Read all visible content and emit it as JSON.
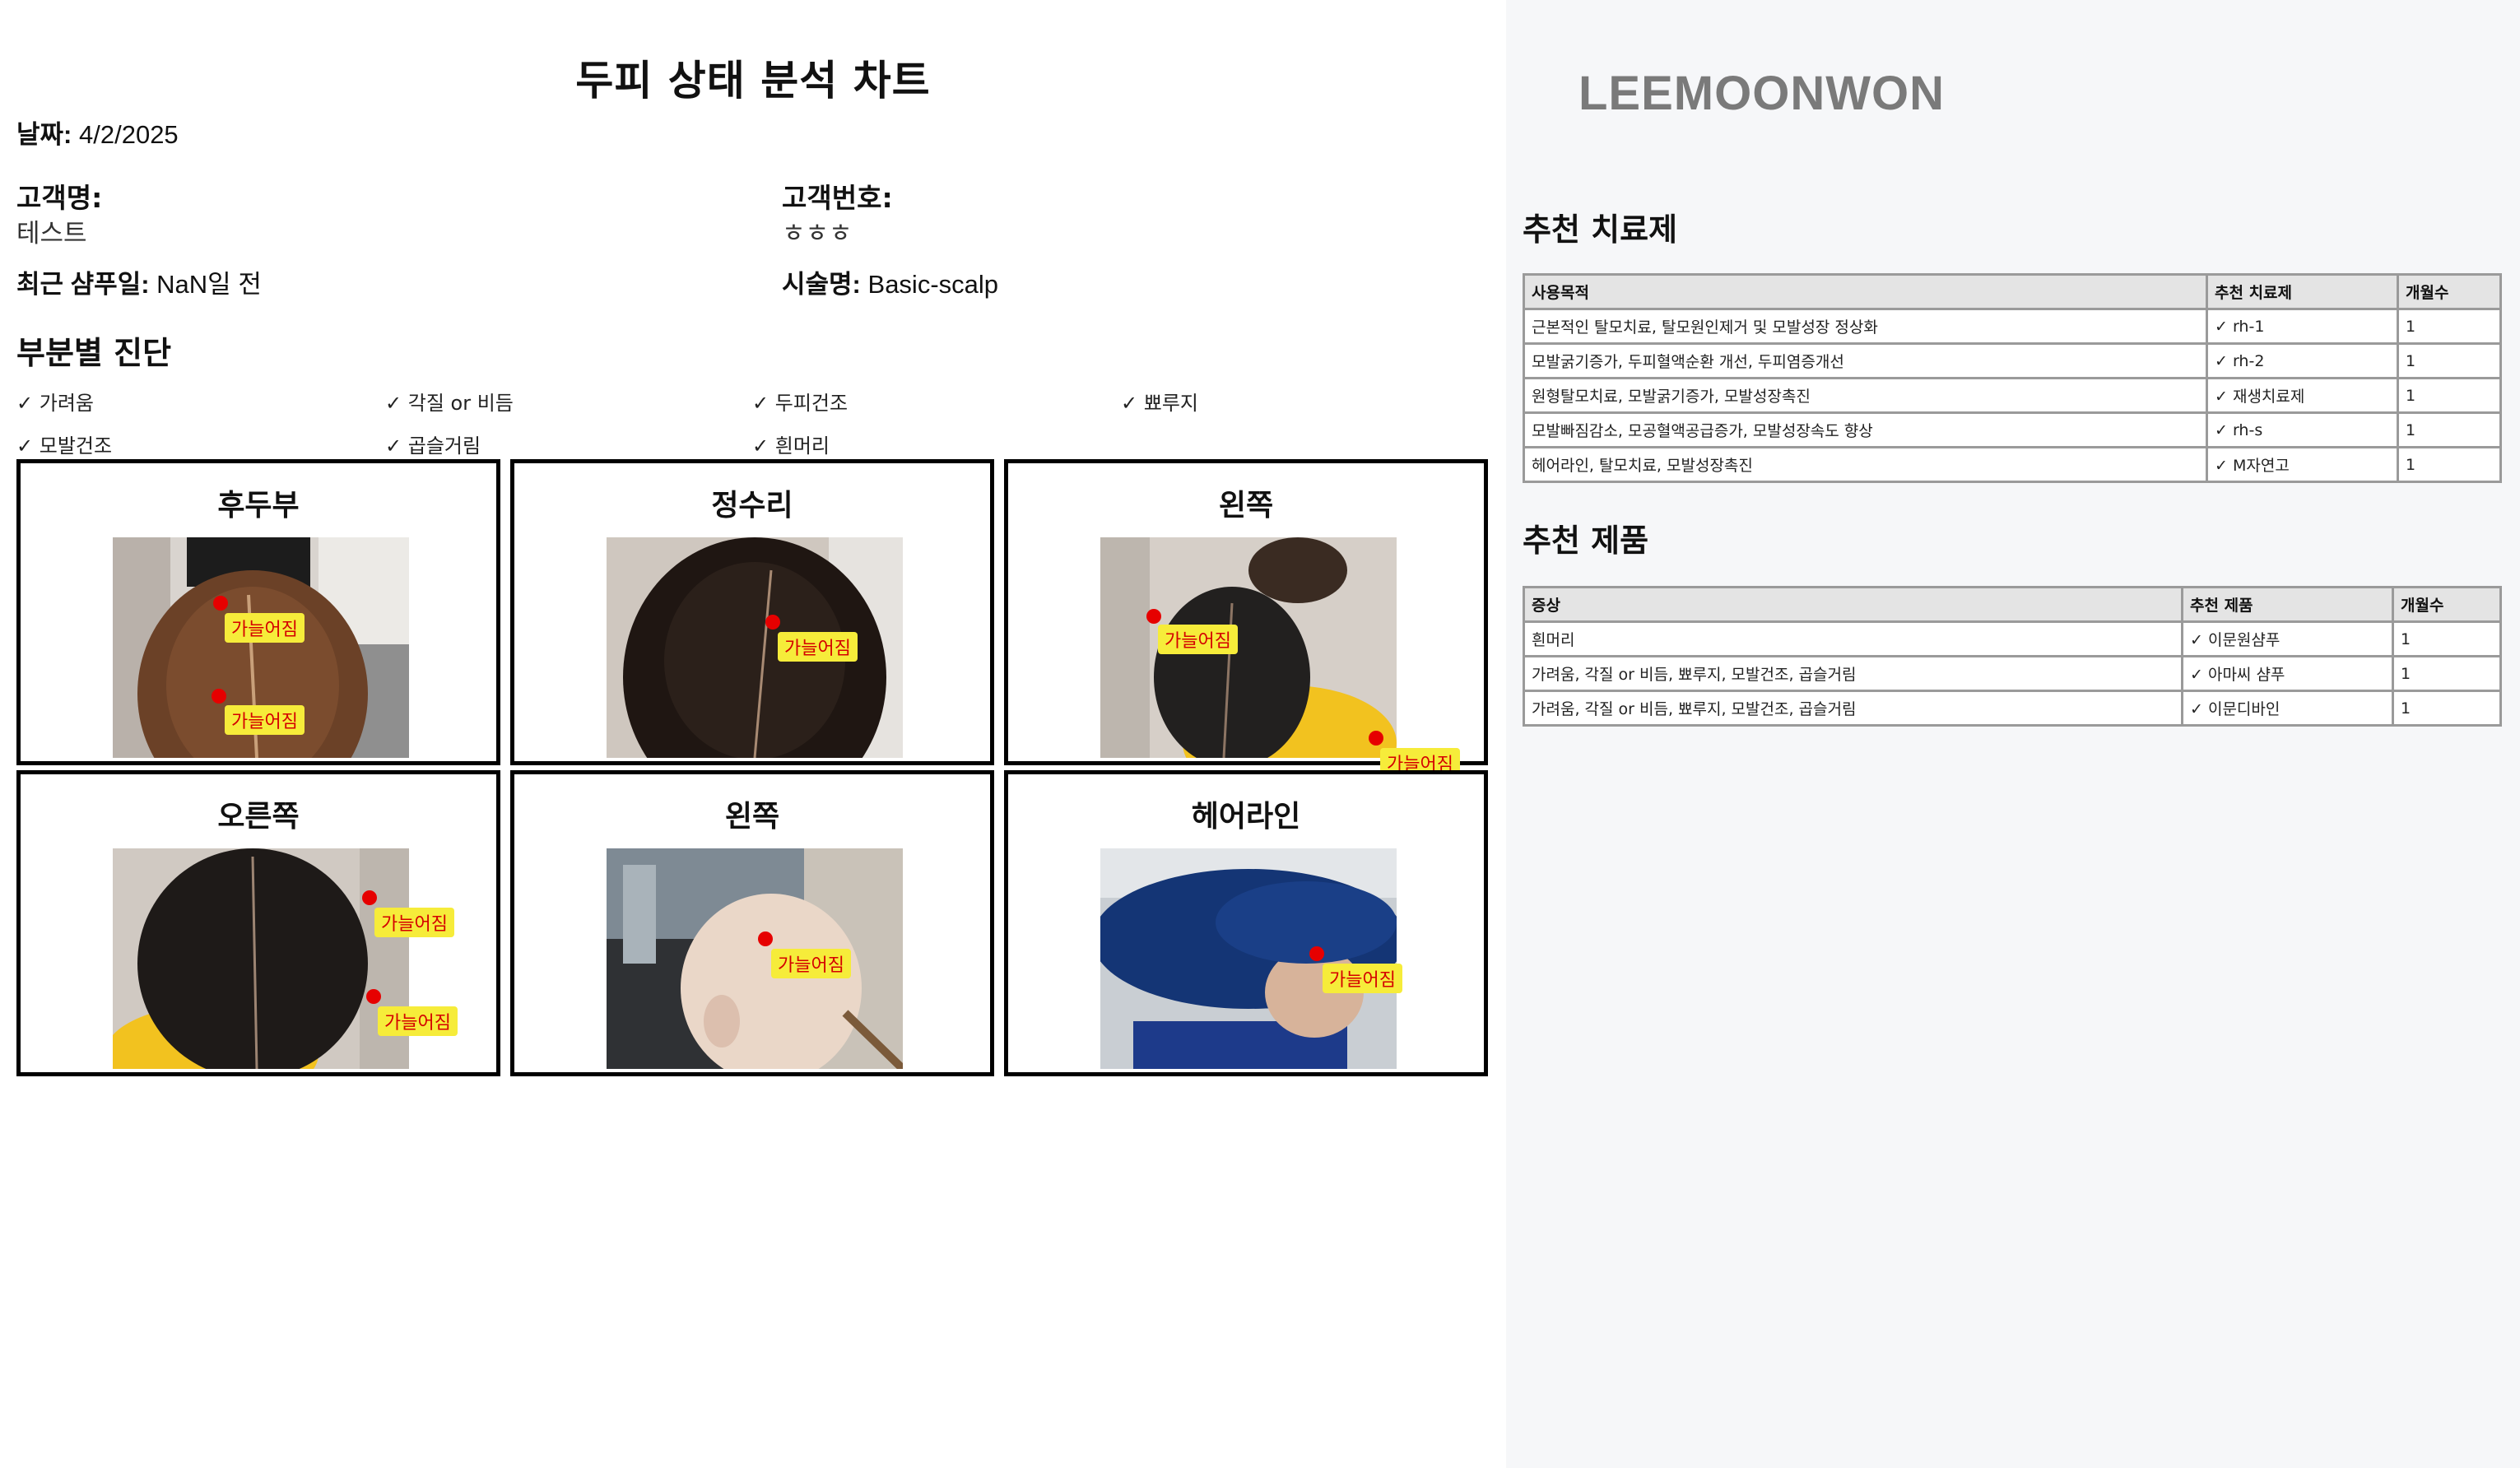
{
  "chart": {
    "title": "두피 상태 분석 차트",
    "date_label": "날짜:",
    "date_value": "4/2/2025",
    "customer_name_label": "고객명:",
    "customer_name_value": "테스트",
    "customer_number_label": "고객번호:",
    "customer_number_value": "ㅎㅎㅎ",
    "last_shampoo_label": "최근 샴푸일:",
    "last_shampoo_value": "NaN일 전",
    "procedure_label": "시술명:",
    "procedure_value": "Basic-scalp"
  },
  "diagnosis": {
    "title": "부분별 진단",
    "symptoms": [
      "✓ 가려움",
      "✓ 각질 or 비듬",
      "✓ 두피건조",
      "✓ 뾰루지",
      "✓ 모발건조",
      "✓ 곱슬거림",
      "✓ 흰머리"
    ]
  },
  "panels": [
    {
      "title": "후두부",
      "photo": "back-of-head-photo",
      "markers": [
        {
          "tag": "가늘어짐"
        },
        {
          "tag": "가늘어짐"
        }
      ]
    },
    {
      "title": "정수리",
      "photo": "crown-photo",
      "markers": [
        {
          "tag": "가늘어짐"
        }
      ]
    },
    {
      "title": "왼쪽",
      "photo": "left-side-photo",
      "markers": [
        {
          "tag": "가늘어짐"
        },
        {
          "tag": "가늘어짐"
        }
      ]
    },
    {
      "title": "오른쪽",
      "photo": "right-side-photo",
      "markers": [
        {
          "tag": "가늘어짐"
        },
        {
          "tag": "가늘어짐"
        }
      ]
    },
    {
      "title": "왼쪽",
      "photo": "left-side-photo-2",
      "markers": [
        {
          "tag": "가늘어짐"
        }
      ]
    },
    {
      "title": "헤어라인",
      "photo": "hairline-photo",
      "markers": [
        {
          "tag": "가늘어짐"
        }
      ]
    }
  ],
  "brand": "LEEMOONWON",
  "treatments": {
    "title": "추천 치료제",
    "headers": [
      "사용목적",
      "추천 치료제",
      "개월수"
    ],
    "rows": [
      [
        "근본적인 탈모치료, 탈모원인제거 및 모발성장 정상화",
        "✓ rh-1",
        "1"
      ],
      [
        "모발굵기증가, 두피혈액순환 개선, 두피염증개선",
        "✓ rh-2",
        "1"
      ],
      [
        "원형탈모치료, 모발굵기증가, 모발성장촉진",
        "✓ 재생치료제",
        "1"
      ],
      [
        "모발빠짐감소, 모공혈액공급증가, 모발성장속도 향상",
        "✓ rh-s",
        "1"
      ],
      [
        "헤어라인, 탈모치료, 모발성장촉진",
        "✓ M자연고",
        "1"
      ]
    ]
  },
  "products": {
    "title": "추천 제품",
    "headers": [
      "증상",
      "추천 제품",
      "개월수"
    ],
    "rows": [
      [
        "흰머리",
        "✓ 이문원샴푸",
        "1"
      ],
      [
        "가려움, 각질 or 비듬, 뾰루지, 모발건조, 곱슬거림",
        "✓ 아마씨 샴푸",
        "1"
      ],
      [
        "가려움, 각질 or 비듬, 뾰루지, 모발건조, 곱슬거림",
        "✓ 이문디바인",
        "1"
      ]
    ]
  },
  "colors": {
    "marker": "#e60000",
    "tag_bg": "#f6ec3a",
    "tag_text": "#d40000",
    "right_bg": "#f6f7f9",
    "brand": "#7a7a7a"
  }
}
